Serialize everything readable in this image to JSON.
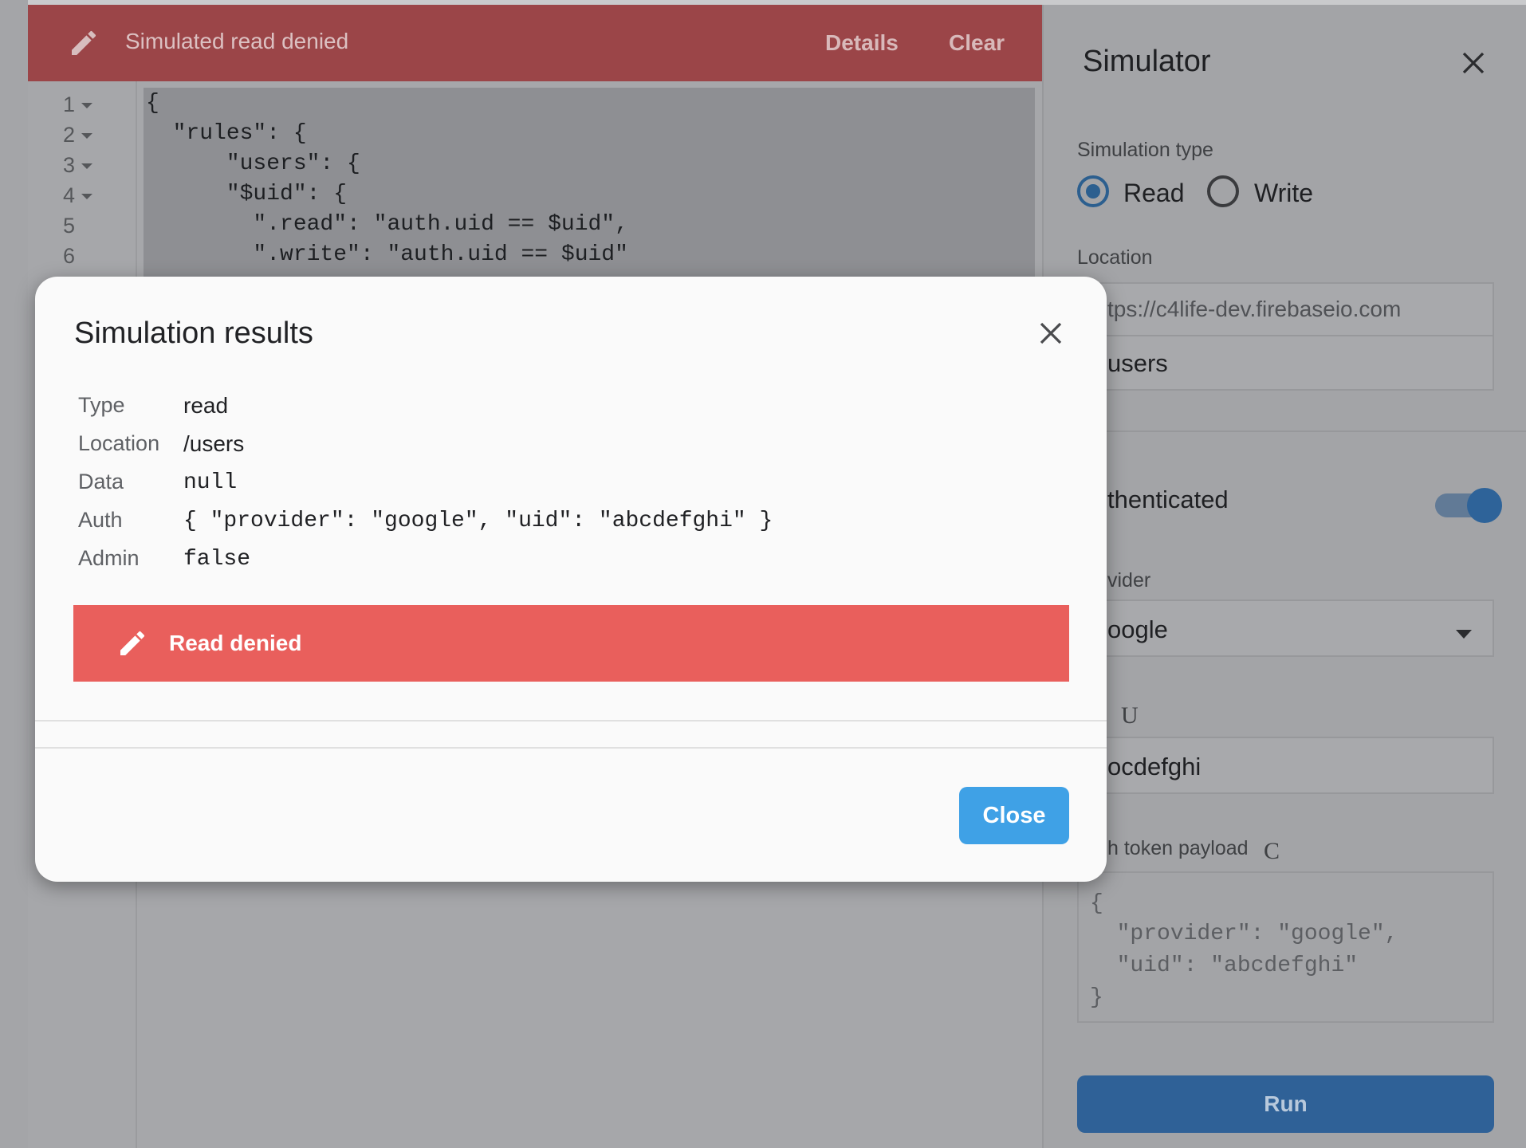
{
  "banner": {
    "title": "Simulated read denied",
    "details_label": "Details",
    "clear_label": "Clear"
  },
  "editor": {
    "line_numbers": [
      "1",
      "2",
      "3",
      "4",
      "5",
      "6"
    ],
    "code_lines": [
      "{",
      "  \"rules\": {",
      "      \"users\": {",
      "      \"$uid\": {",
      "        \".read\": \"auth.uid == $uid\",",
      "        \".write\": \"auth.uid == $uid\""
    ]
  },
  "simulator": {
    "title": "Simulator",
    "simulation_type_label": "Simulation type",
    "read_label": "Read",
    "write_label": "Write",
    "selected_type": "Read",
    "location_label": "Location",
    "location_base": "tps://c4life-dev.firebaseio.com",
    "location_path": "users",
    "authenticated_label": "thenticated",
    "authenticated": true,
    "provider_label": "vider",
    "provider_value": "oogle",
    "uid_label_glyph": "U",
    "uid_value": "ocdefghi",
    "token_payload_label": "h token payload",
    "token_label_glyph": "C",
    "token_payload_lines": [
      "{",
      "  \"provider\": \"google\",",
      "  \"uid\": \"abcdefghi\"",
      "}"
    ],
    "run_label": "Run"
  },
  "modal": {
    "title": "Simulation results",
    "rows": [
      {
        "label": "Type",
        "value": "read"
      },
      {
        "label": "Location",
        "value": "/users"
      },
      {
        "label": "Data",
        "value": "null"
      },
      {
        "label": "Auth",
        "value": "{ \"provider\": \"google\", \"uid\": \"abcdefghi\" }"
      },
      {
        "label": "Admin",
        "value": "false"
      }
    ],
    "result_text": "Read denied",
    "close_label": "Close"
  },
  "colors": {
    "banner_bg": "#9b4548",
    "denied_bg": "#e95f5c",
    "close_button": "#3fa1e6",
    "run_button": "#2f6197"
  }
}
